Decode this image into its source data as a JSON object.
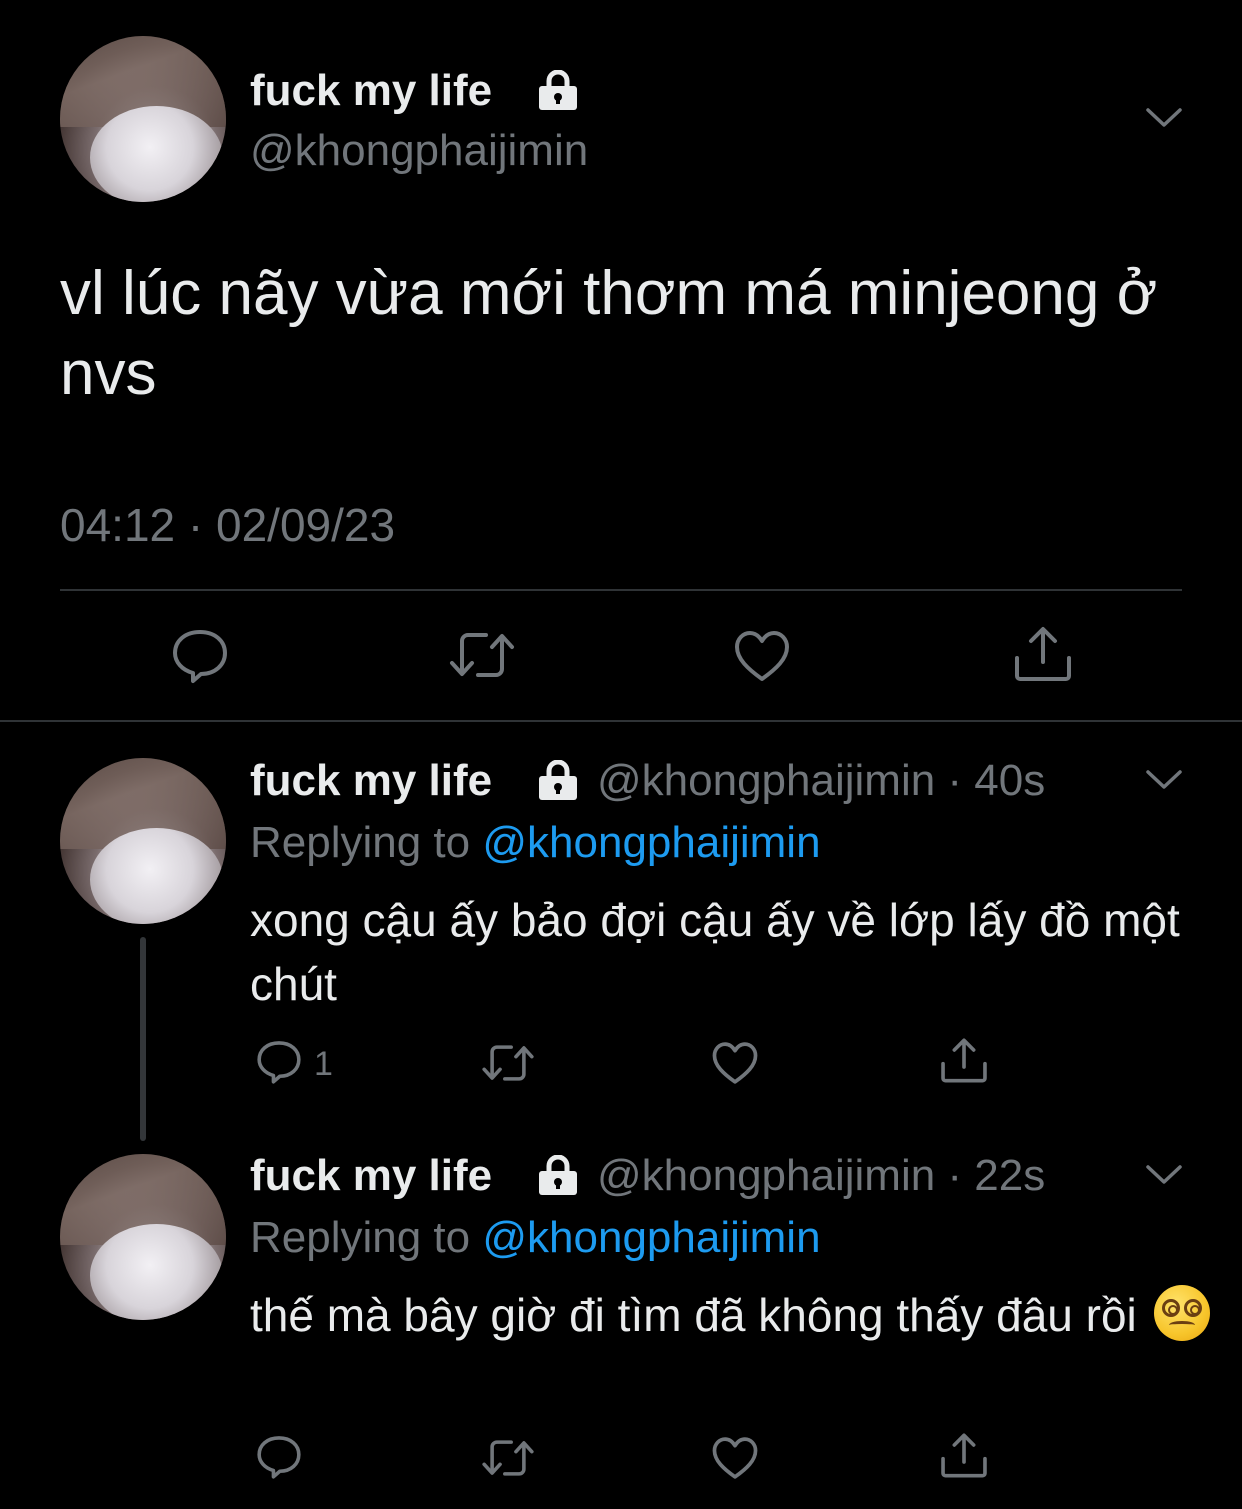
{
  "main_tweet": {
    "display_name": "fuck my life",
    "handle": "@khongphaijimin",
    "text": "vl lúc nãy vừa mới thơm má minjeong ở nvs",
    "timestamp": "04:12 · 02/09/23"
  },
  "replies": [
    {
      "display_name": "fuck my life",
      "handle_time": "@khongphaijimin · 40s",
      "replying_prefix": "Replying to ",
      "replying_to": "@khongphaijimin",
      "text": "xong cậu ấy bảo đợi cậu ấy về lớp lấy đồ một chút",
      "reply_count": "1"
    },
    {
      "display_name": "fuck my life",
      "handle_time": "@khongphaijimin · 22s",
      "replying_prefix": "Replying to ",
      "replying_to": "@khongphaijimin",
      "text": "thế mà bây giờ đi tìm đã không thấy đâu rồi",
      "emoji": "face-with-spiral-eyes"
    }
  ],
  "icons": {
    "protected": "lock-icon",
    "menu": "chevron-down-icon",
    "reply": "reply-icon",
    "retweet": "retweet-icon",
    "like": "heart-icon",
    "share": "share-icon"
  },
  "colors": {
    "background": "#000000",
    "text": "#e9ebec",
    "secondary": "#71767b",
    "accent": "#1d9bf0",
    "divider": "#2f3336"
  }
}
